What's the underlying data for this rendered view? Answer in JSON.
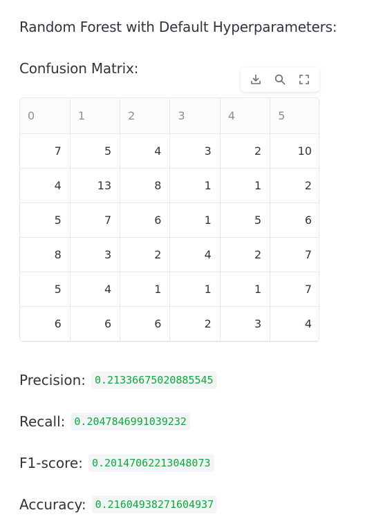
{
  "title": "Random Forest with Default Hyperparameters:",
  "confusion_label": "Confusion Matrix:",
  "toolbar": {
    "icons": [
      "download-icon",
      "search-icon",
      "fullscreen-icon"
    ]
  },
  "matrix": {
    "headers": [
      "0",
      "1",
      "2",
      "3",
      "4",
      "5"
    ],
    "rows": [
      [
        "7",
        "5",
        "4",
        "3",
        "2",
        "10"
      ],
      [
        "4",
        "13",
        "8",
        "1",
        "1",
        "2"
      ],
      [
        "5",
        "7",
        "6",
        "1",
        "5",
        "6"
      ],
      [
        "8",
        "3",
        "2",
        "4",
        "2",
        "7"
      ],
      [
        "5",
        "4",
        "1",
        "1",
        "1",
        "7"
      ],
      [
        "6",
        "6",
        "6",
        "2",
        "3",
        "4"
      ]
    ]
  },
  "metrics": {
    "precision": {
      "label": "Precision:",
      "value": "0.21336675020885545"
    },
    "recall": {
      "label": "Recall:",
      "value": "0.2047846991039232"
    },
    "f1": {
      "label": "F1-score:",
      "value": "0.20147062213048073"
    },
    "accuracy": {
      "label": "Accuracy:",
      "value": "0.21604938271604937"
    }
  },
  "colors": {
    "text": "#31333f",
    "header_text": "#8b8d97",
    "metric_value": "#09ab3b",
    "code_bg": "#f3f4f6"
  }
}
